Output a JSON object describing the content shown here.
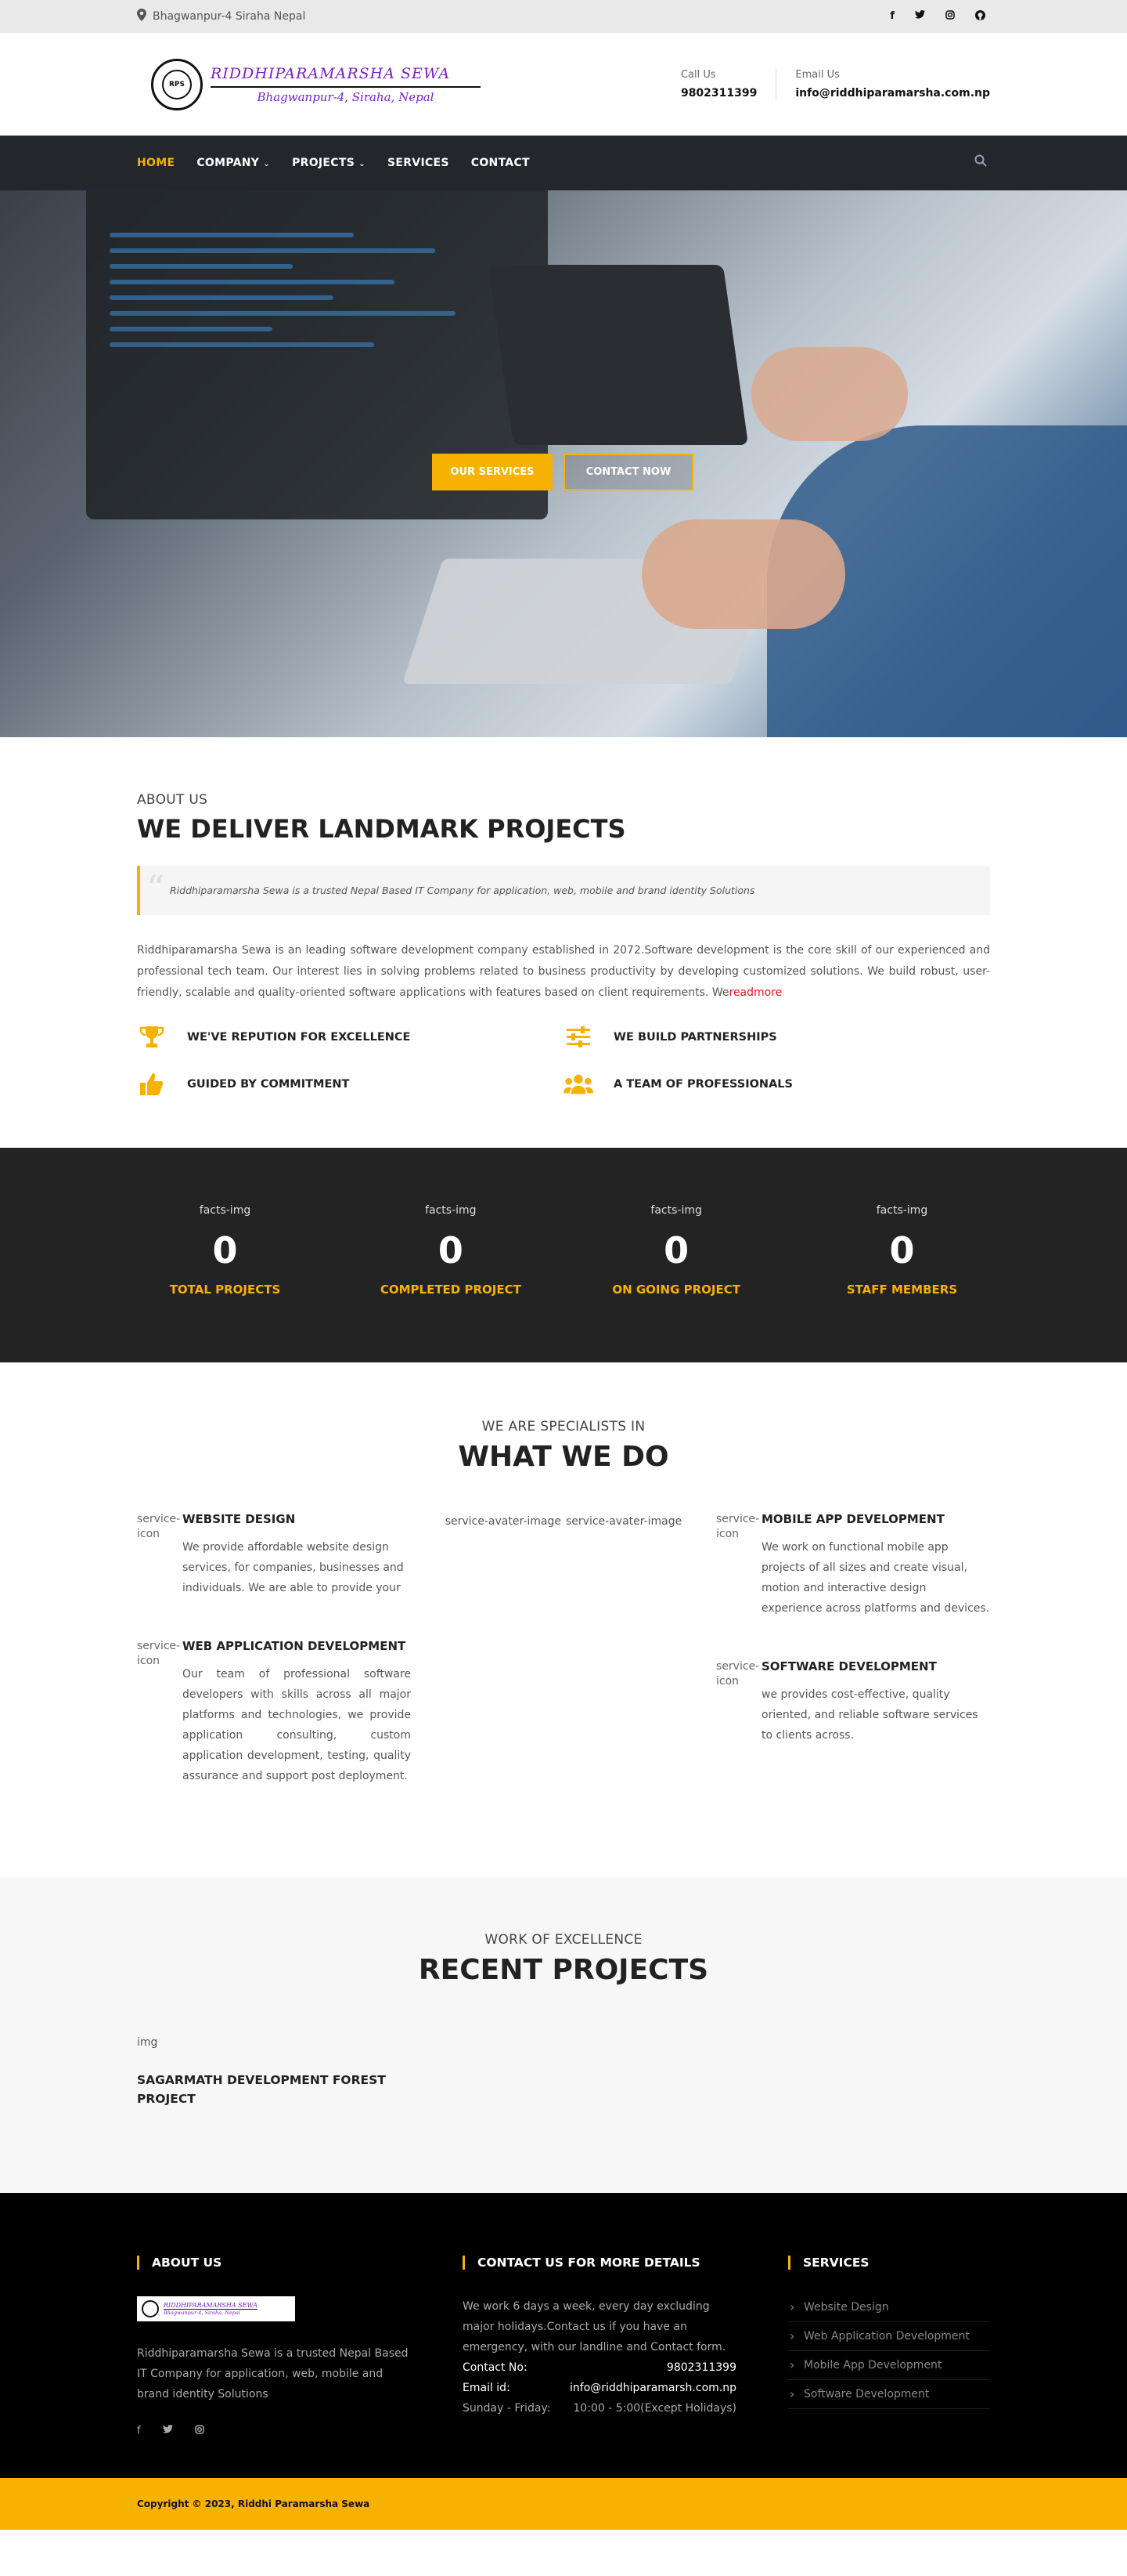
{
  "topbar": {
    "address": "Bhagwanpur-4 Siraha Nepal",
    "social": [
      "facebook-icon",
      "twitter-icon",
      "instagram-icon",
      "github-icon"
    ]
  },
  "header": {
    "logo_name": "RIDDHIPARAMARSHA SEWA",
    "logo_sub": "Bhagwanpur-4, Siraha, Nepal",
    "call_label": "Call Us",
    "call_value": "9802311399",
    "email_label": "Email Us",
    "email_value": "info@riddhiparamarsha.com.np"
  },
  "nav": {
    "items": [
      "HOME",
      "COMPANY",
      "PROJECTS",
      "SERVICES",
      "CONTACT"
    ],
    "active": "HOME"
  },
  "hero": {
    "btn_services": "OUR SERVICES",
    "btn_contact": "CONTACT NOW"
  },
  "about": {
    "subtitle": "ABOUT US",
    "title": "WE DELIVER LANDMARK PROJECTS",
    "quote": "Riddhiparamarsha Sewa  is a trusted Nepal Based IT Company for application, web, mobile and brand identity Solutions",
    "text": "Riddhiparamarsha Sewa is an leading software development company established in 2072.Software development is the core skill of our experienced and professional tech team. Our interest lies in solving problems related to business productivity by developing customized solutions. We build robust, user-friendly, scalable and quality-oriented software applications with features based on client requirements. We",
    "readmore": "readmore",
    "features": [
      {
        "icon": "trophy-icon",
        "label": "WE'VE REPUTION FOR EXCELLENCE"
      },
      {
        "icon": "sliders-icon",
        "label": "WE BUILD PARTNERSHIPS"
      },
      {
        "icon": "thumbs-up-icon",
        "label": "GUIDED BY COMMITMENT"
      },
      {
        "icon": "users-icon",
        "label": "A TEAM OF PROFESSIONALS"
      }
    ]
  },
  "facts": [
    {
      "img": "facts-img",
      "value": "0",
      "label": "TOTAL PROJECTS"
    },
    {
      "img": "facts-img",
      "value": "0",
      "label": "COMPLETED PROJECT"
    },
    {
      "img": "facts-img",
      "value": "0",
      "label": "ON GOING PROJECT"
    },
    {
      "img": "facts-img",
      "value": "0",
      "label": "STAFF MEMBERS"
    }
  ],
  "services": {
    "subtitle": "WE ARE SPECIALISTS IN",
    "title": "WHAT WE DO",
    "icon_alt": "service-icon",
    "avatar_alt": "service-avater-image",
    "left": [
      {
        "title": "WEBSITE DESIGN",
        "text": "We provide affordable website design services, for companies, businesses and individuals. We are able to provide your"
      },
      {
        "title": "WEB APPLICATION DEVELOPMENT",
        "text": "Our team of professional software developers with skills across all major platforms and technologies, we provide application consulting, custom application development, testing, quality assurance and support post deployment."
      }
    ],
    "right": [
      {
        "title": "MOBILE APP DEVELOPMENT",
        "text": "We work on functional mobile app projects of all sizes and create visual, motion and interactive design experience across platforms and devices."
      },
      {
        "title": "SOFTWARE DEVELOPMENT",
        "text": "we provides cost-effective, quality oriented, and reliable software services to clients across."
      }
    ]
  },
  "projects": {
    "subtitle": "WORK OF EXCELLENCE",
    "title": "RECENT PROJECTS",
    "items": [
      {
        "img": "img",
        "title": "SAGARMATH DEVELOPMENT FOREST PROJECT"
      }
    ]
  },
  "footer": {
    "about_title": "ABOUT US",
    "about_logo_name": "RIDDHIPARAMARSHA SEWA",
    "about_logo_sub": "Bhagwanpur-4, Siraha, Nepal",
    "about_text": "Riddhiparamarsha Sewa is a trusted Nepal Based IT Company for application, web, mobile and brand identity Solutions",
    "contact_title": "CONTACT US FOR MORE DETAILS",
    "contact_text": "We work 6 days a week, every day excluding major holidays.Contact us if you have an emergency, with our landline and Contact form.",
    "contact_no_label": "Contact No:",
    "contact_no": "9802311399",
    "email_label": "Email id:",
    "email": "info@riddhiparamarsh.com.np",
    "hours_label": "Sunday - Friday:",
    "hours": "10:00 - 5:00(Except Holidays)",
    "services_title": "SERVICES",
    "services": [
      "Website Design",
      "Web Application Development",
      "Mobile App Development",
      "Software Development"
    ]
  },
  "copyright": "Copyright © 2023, Riddhi Paramarsha Sewa",
  "colors": {
    "accent": "#f7b201",
    "dark": "#23262b",
    "readmore": "#e4151a"
  }
}
